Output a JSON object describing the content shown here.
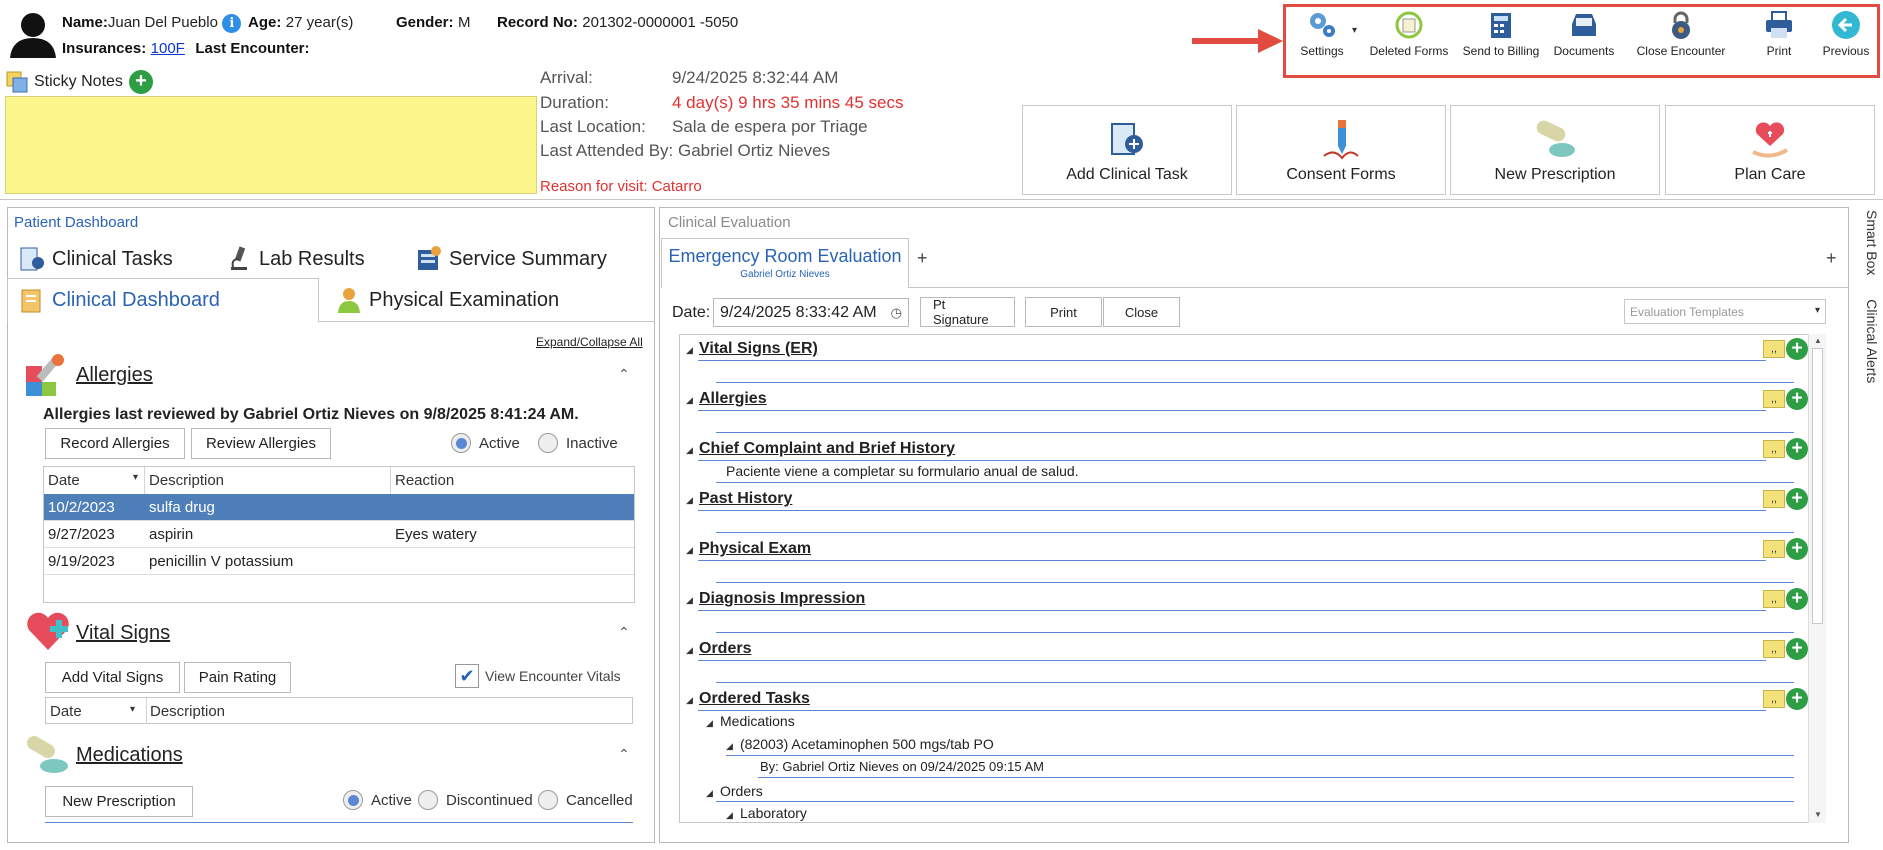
{
  "patient": {
    "name_label": "Name:",
    "name": "Juan Del Pueblo",
    "age_label": "Age:",
    "age": "27 year(s)",
    "gender_label": "Gender:",
    "gender": "M",
    "record_label": "Record No:",
    "record": "201302-0000001 -5050",
    "insurances_label": "Insurances:",
    "insurance": "100F",
    "last_encounter_label": "Last Encounter:"
  },
  "sticky_notes_label": "Sticky Notes",
  "encounter": {
    "arrival_label": "Arrival:",
    "arrival": "9/24/2025 8:32:44 AM",
    "duration_label": "Duration:",
    "duration": "4 day(s) 9 hrs 35 mins 45 secs",
    "last_location_label": "Last Location:",
    "last_location": "Sala de espera por Triage",
    "last_attended_label": "Last Attended By:",
    "last_attended": "Gabriel Ortiz Nieves",
    "reason": "Reason for visit: Catarro"
  },
  "toolbar": {
    "settings": "Settings",
    "deleted_forms": "Deleted Forms",
    "send_to_billing": "Send to Billing",
    "documents": "Documents",
    "close_encounter": "Close Encounter",
    "print": "Print",
    "previous": "Previous"
  },
  "actions": {
    "add_clinical_task": "Add Clinical Task",
    "consent_forms": "Consent Forms",
    "new_prescription": "New Prescription",
    "plan_care": "Plan Care"
  },
  "left": {
    "title": "Patient Dashboard",
    "tabs": {
      "clinical_tasks": "Clinical Tasks",
      "lab_results": "Lab Results",
      "service_summary": "Service Summary",
      "clinical_dashboard": "Clinical Dashboard",
      "physical_examination": "Physical Examination"
    },
    "expand_collapse": "Expand/Collapse All",
    "allergies": {
      "title": "Allergies",
      "reviewed": "Allergies last reviewed by Gabriel Ortiz Nieves on 9/8/2025 8:41:24 AM.",
      "record_btn": "Record Allergies",
      "review_btn": "Review Allergies",
      "active": "Active",
      "inactive": "Inactive",
      "columns": [
        "Date",
        "Description",
        "Reaction"
      ],
      "rows": [
        [
          "10/2/2023",
          "sulfa drug",
          ""
        ],
        [
          "9/27/2023",
          "aspirin",
          "Eyes watery"
        ],
        [
          "9/19/2023",
          "penicillin V potassium",
          ""
        ]
      ]
    },
    "vitals": {
      "title": "Vital Signs",
      "add_btn": "Add Vital Signs",
      "pain_btn": "Pain Rating",
      "view_encounter": "View Encounter Vitals",
      "columns": [
        "Date",
        "Description"
      ]
    },
    "medications": {
      "title": "Medications",
      "new_btn": "New Prescription",
      "active": "Active",
      "discontinued": "Discontinued",
      "cancelled": "Cancelled"
    }
  },
  "right": {
    "title": "Clinical Evaluation",
    "tab_title": "Emergency Room Evaluation",
    "tab_sub": "Gabriel Ortiz Nieves",
    "date_label": "Date:",
    "date": "9/24/2025 8:33:42 AM",
    "pt_signature": "Pt Signature",
    "print": "Print",
    "close": "Close",
    "templates_placeholder": "Evaluation Templates",
    "sections": [
      "Vital Signs (ER)",
      "Allergies",
      "Chief Complaint and Brief History",
      "Past History",
      "Physical Exam",
      "Diagnosis Impression",
      "Orders",
      "Ordered Tasks"
    ],
    "complaint_text": "Paciente viene a completar su formulario anual de salud.",
    "ordered": {
      "medications": "Medications",
      "med_item": "(82003) Acetaminophen 500 mgs/tab PO",
      "med_by": "By: Gabriel Ortiz Nieves on 09/24/2025 09:15 AM",
      "orders": "Orders",
      "laboratory": "Laboratory"
    }
  },
  "side_tabs": {
    "smart_box": "Smart Box",
    "clinical_alerts": "Clinical Alerts"
  }
}
